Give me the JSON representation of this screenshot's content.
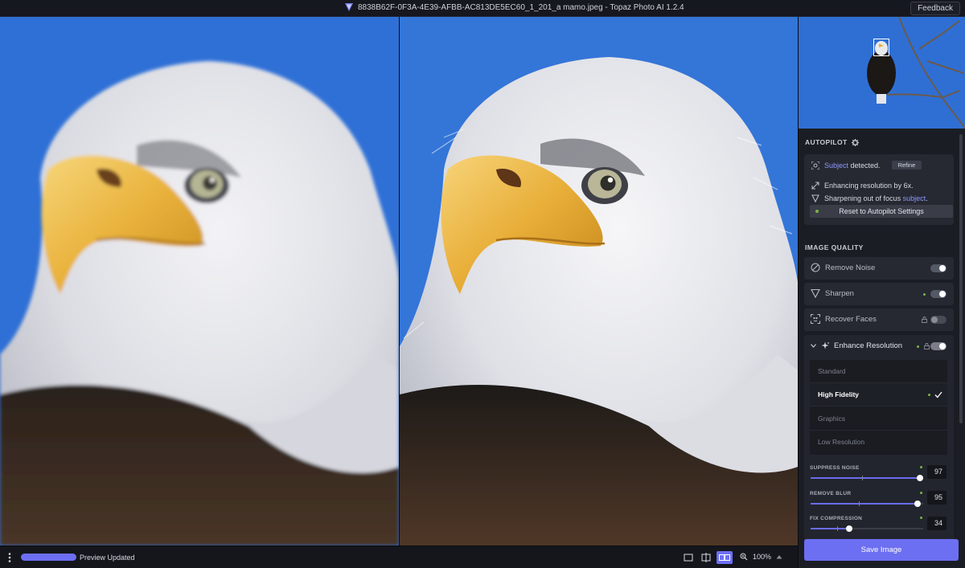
{
  "titlebar": {
    "title": "8838B62F-0F3A-4E39-AFBB-AC813DE5EC60_1_201_a mamo.jpeg - Topaz Photo AI 1.2.4",
    "feedback_label": "Feedback"
  },
  "autopilot": {
    "heading": "AUTOPILOT",
    "subject_word": "Subject",
    "subject_detected_text": " detected.",
    "refine_label": "Refine",
    "enhancing_text": "Enhancing resolution by 6x.",
    "sharpening_text": "Sharpening out of focus ",
    "sharpening_subject": "subject",
    "sharpening_end": ".",
    "reset_label": "Reset to Autopilot Settings"
  },
  "image_quality": {
    "heading": "IMAGE QUALITY",
    "rows": [
      {
        "label": "Remove Noise",
        "enabled": true,
        "locked": false,
        "dot": false
      },
      {
        "label": "Sharpen",
        "enabled": true,
        "locked": false,
        "dot": true
      },
      {
        "label": "Recover Faces",
        "enabled": false,
        "locked": true,
        "dot": false
      }
    ],
    "enhance_resolution": {
      "label": "Enhance Resolution",
      "enabled": true,
      "models": [
        "Standard",
        "High Fidelity",
        "Graphics",
        "Low Resolution"
      ],
      "selected_model": "High Fidelity",
      "sliders": [
        {
          "label": "SUPPRESS NOISE",
          "value": "97",
          "fraction": 0.97
        },
        {
          "label": "REMOVE BLUR",
          "value": "95",
          "fraction": 0.95
        },
        {
          "label": "FIX COMPRESSION",
          "value": "34",
          "fraction": 0.34
        }
      ]
    }
  },
  "save_label": "Save Image",
  "bottombar": {
    "status": "Preview Updated",
    "zoom": "100%",
    "progress": 1.0,
    "view_mode": "side-by-side"
  },
  "colors": {
    "accent": "#6d6ff2",
    "sky": "#2f6fd4",
    "active_dot": "#7ab344"
  }
}
